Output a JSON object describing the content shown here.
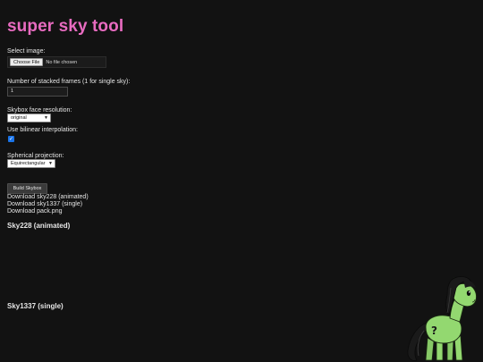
{
  "app": {
    "title": "super sky tool",
    "title_color": "#e86bc0"
  },
  "form": {
    "select_image_label": "Select image:",
    "file_button_label": "Choose File",
    "file_status": "No file chosen",
    "stacked_frames_label": "Number of stacked frames (1 for single sky):",
    "stacked_frames_value": "1",
    "face_resolution_label": "Skybox face resolution:",
    "face_resolution_value": "original",
    "bilinear_label": "Use bilinear interpolation:",
    "bilinear_checked": true,
    "projection_label": "Spherical projection:",
    "projection_value": "Equirectangular",
    "build_button_label": "Build Skybox",
    "checkbox_color": "#1a73e8"
  },
  "downloads": [
    "Download sky228 (animated)",
    "Download sky1337 (single)",
    "Download pack.png"
  ],
  "sections": {
    "animated_heading": "Sky228 (animated)",
    "single_heading": "Sky1337 (single)"
  },
  "mascot": {
    "icon": "pony-mascot",
    "coat_color": "#93d870",
    "mane_color": "#1a1a1a",
    "mark": "?"
  }
}
